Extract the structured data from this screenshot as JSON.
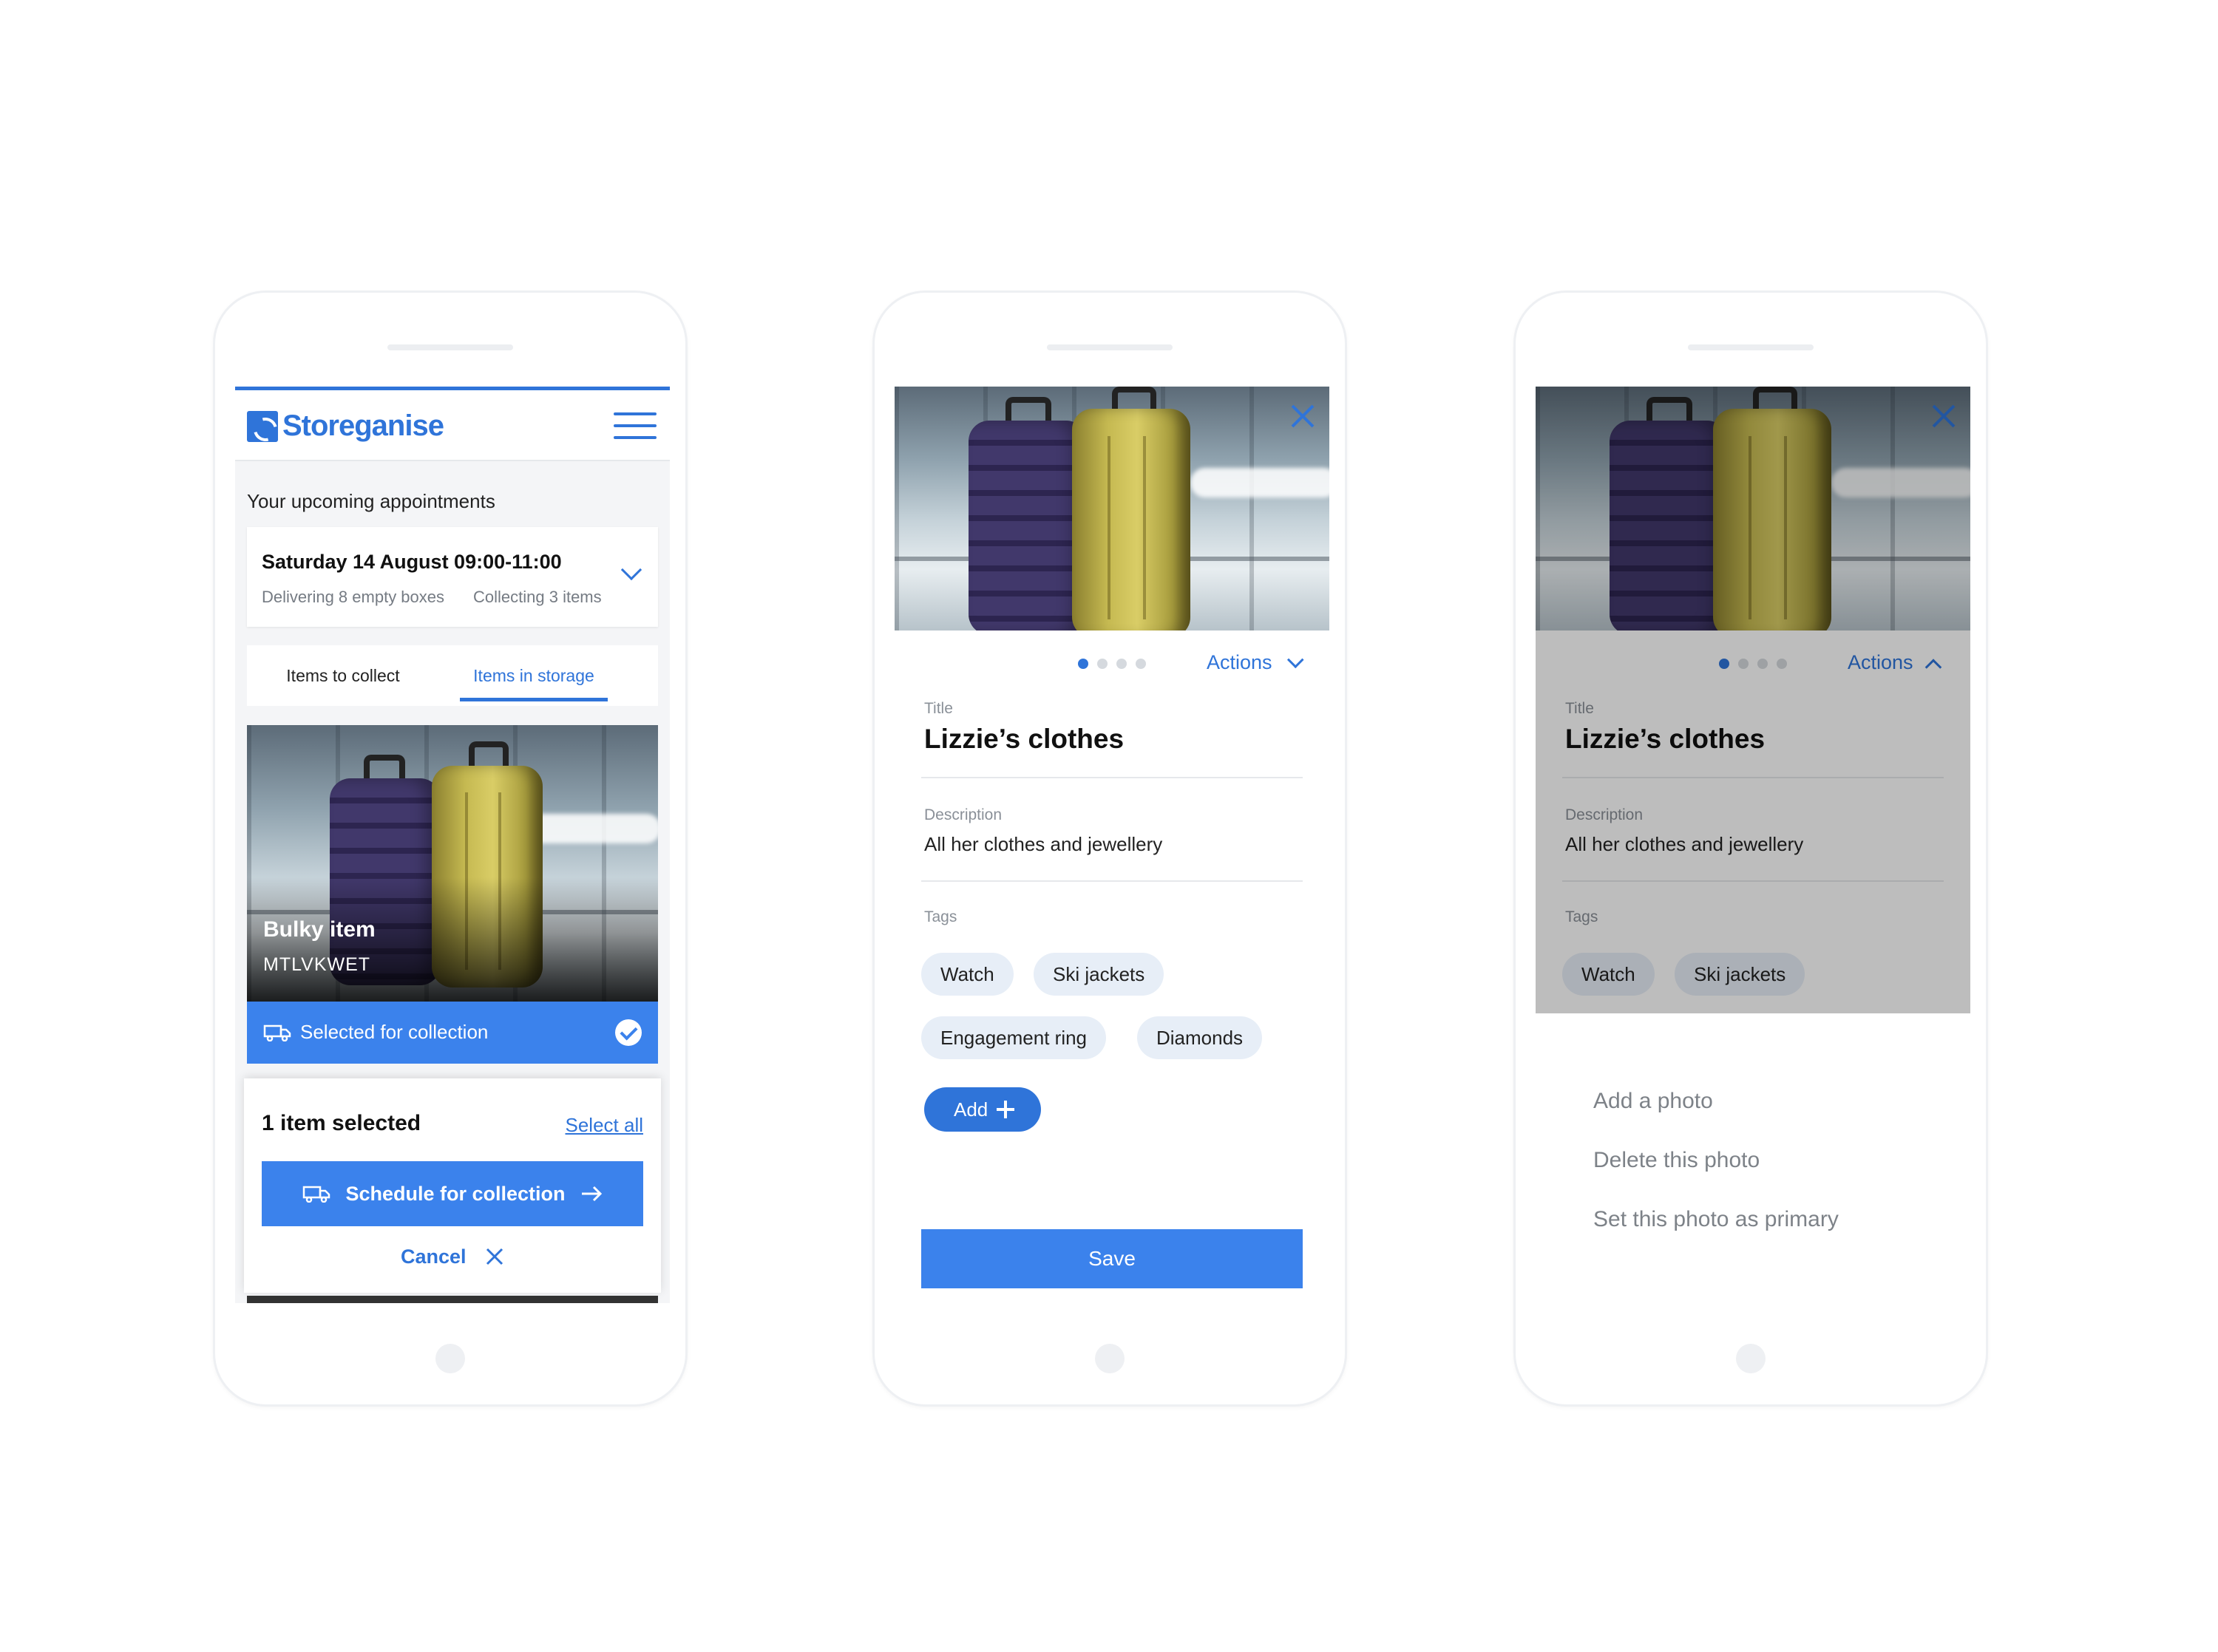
{
  "phone1": {
    "brand": "Storeganise",
    "appointments_title": "Your upcoming appointments",
    "appointment": {
      "date": "Saturday 14 August 09:00-11:00",
      "delivering": "Delivering 8 empty boxes",
      "collecting": "Collecting 3 items"
    },
    "tabs": [
      "Items to collect",
      "Items in storage"
    ],
    "active_tab": "Items in storage",
    "item": {
      "name": "Bulky item",
      "code": "MTLVKWET",
      "status": "Selected for collection"
    },
    "sheet": {
      "count": "1 item selected",
      "select_all": "Select all",
      "schedule": "Schedule for collection",
      "cancel": "Cancel"
    }
  },
  "phone2": {
    "actions": "Actions",
    "title_label": "Title",
    "title": "Lizzie’s clothes",
    "description_label": "Description",
    "description": "All her clothes and jewellery",
    "tags_label": "Tags",
    "tags": [
      "Watch",
      "Ski jackets",
      "Engagement ring",
      "Diamonds"
    ],
    "add": "Add",
    "save": "Save",
    "photo_count": 4,
    "active_photo": 1
  },
  "phone3": {
    "actions": "Actions",
    "title_label": "Title",
    "title": "Lizzie’s clothes",
    "description_label": "Description",
    "description": "All her clothes and jewellery",
    "tags_label": "Tags",
    "tags": [
      "Watch",
      "Ski jackets"
    ],
    "menu": [
      "Add a photo",
      "Delete this photo",
      "Set this photo as primary"
    ]
  },
  "colors": {
    "accent": "#2f74d9",
    "accent_button": "#3b82ec",
    "tag_bg": "#e7eef7"
  },
  "icons": [
    "hamburger-icon",
    "chevron-down-icon",
    "truck-icon",
    "check-icon",
    "arrow-right-icon",
    "close-icon",
    "plus-icon",
    "chevron-up-icon"
  ]
}
